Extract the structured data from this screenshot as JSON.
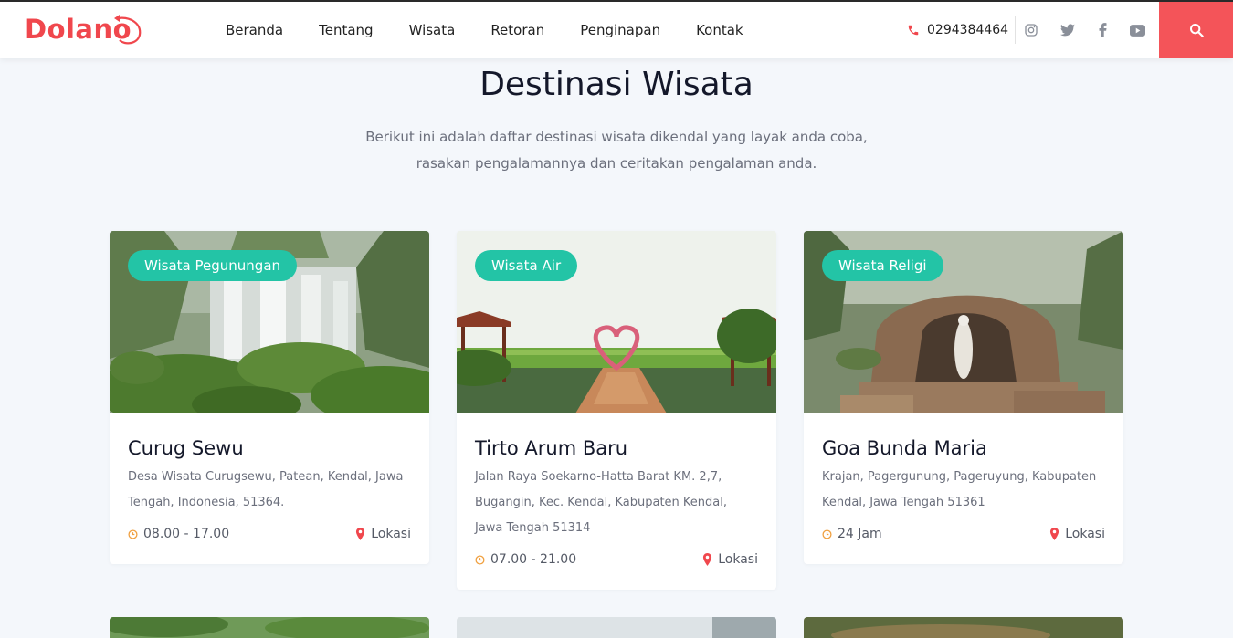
{
  "brand": {
    "name": "Dolano",
    "color": "#f0474d"
  },
  "nav": {
    "items": [
      {
        "label": "Beranda"
      },
      {
        "label": "Tentang"
      },
      {
        "label": "Wisata"
      },
      {
        "label": "Retoran"
      },
      {
        "label": "Penginapan"
      },
      {
        "label": "Kontak"
      }
    ]
  },
  "contact": {
    "phone": "0294384464",
    "icon": "phone-icon"
  },
  "social": [
    "instagram-icon",
    "twitter-icon",
    "facebook-icon",
    "youtube-icon"
  ],
  "search": {
    "icon": "search-icon",
    "color": "#f45459"
  },
  "section": {
    "title": "Destinasi Wisata",
    "subtitle_line1": "Berikut ini adalah daftar destinasi wisata dikendal yang layak anda coba,",
    "subtitle_line2": "rasakan pengalamannya dan ceritakan pengalaman anda."
  },
  "cards": [
    {
      "badge": "Wisata Pegunungan",
      "name": "Curug Sewu",
      "address": "Desa Wisata Curugsewu, Patean, Kendal, Jawa Tengah, Indonesia, 51364.",
      "hours": "08.00 - 17.00",
      "location_label": "Lokasi"
    },
    {
      "badge": "Wisata Air",
      "name": "Tirto Arum Baru",
      "address": "Jalan Raya Soekarno-Hatta Barat KM. 2,7, Bugangin, Kec. Kendal, Kabupaten Kendal, Jawa Tengah 51314",
      "hours": "07.00 - 21.00",
      "location_label": "Lokasi"
    },
    {
      "badge": "Wisata Religi",
      "name": "Goa Bunda Maria",
      "address": "Krajan, Pagergunung, Pageruyung, Kabupaten Kendal, Jawa Tengah 51361",
      "hours": "24 Jam",
      "location_label": "Lokasi"
    }
  ],
  "colors": {
    "badge": "#23c4a6",
    "clock": "#f0a040",
    "pin": "#f0474d"
  }
}
